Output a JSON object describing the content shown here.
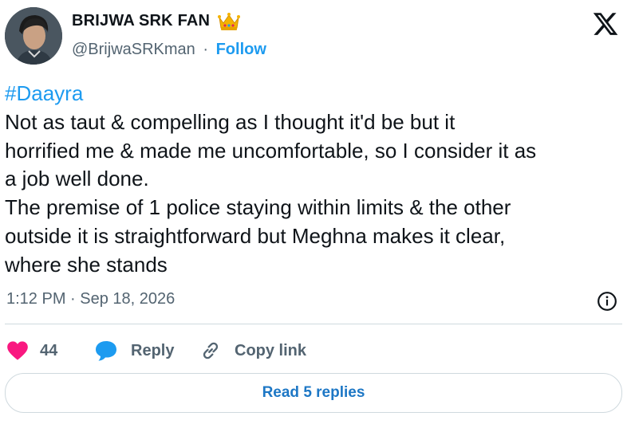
{
  "author": {
    "name": "BRIJWA SRK FAN",
    "handle": "@BrijwaSRKman",
    "separator": "·",
    "follow_label": "Follow"
  },
  "tweet": {
    "hashtag": "#Daayra",
    "lines": [
      "Not as taut & compelling as I thought it'd be but it",
      "horrified me & made me uncomfortable, so I consider it as",
      "a job well done.",
      "The premise of 1 police staying within limits & the other",
      "outside it is straightforward but Meghna makes it clear,",
      "where she stands"
    ],
    "timestamp": "1:12 PM · Sep 18, 2026"
  },
  "actions": {
    "like_count": "44",
    "reply_label": "Reply",
    "copy_link_label": "Copy link"
  },
  "footer": {
    "read_replies_label": "Read 5 replies"
  },
  "colors": {
    "accent": "#1d9bf0",
    "like": "#f91880",
    "muted_text": "#536471"
  }
}
